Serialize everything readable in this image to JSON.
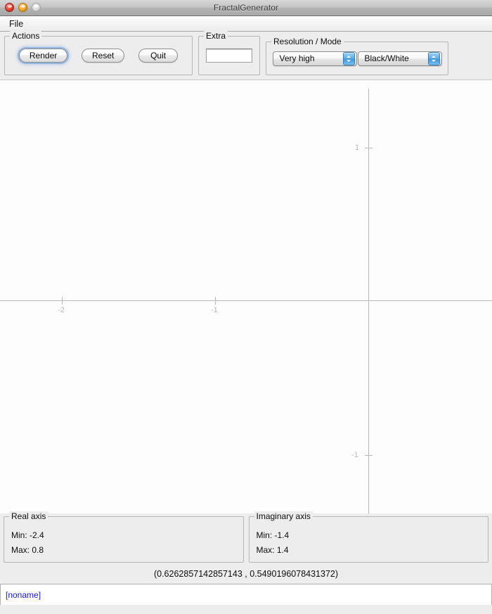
{
  "window": {
    "title": "FractalGenerator",
    "controls": [
      "close-button",
      "minimize-button",
      "zoom-button"
    ]
  },
  "menubar": {
    "items": [
      {
        "label": "File"
      }
    ]
  },
  "toolbar": {
    "actions_group": {
      "label": "Actions",
      "buttons": [
        {
          "label": "Render",
          "default": true
        },
        {
          "label": "Reset",
          "default": false
        },
        {
          "label": "Quit",
          "default": false
        }
      ]
    },
    "extra_group": {
      "label": "Extra",
      "field_value": "",
      "field_placeholder": ""
    },
    "resolution_mode_group": {
      "label": "Resolution / Mode",
      "resolution": {
        "value": "Very high"
      },
      "mode": {
        "value": "Black/White"
      }
    }
  },
  "plot": {
    "x_tick_labels": [
      "-2",
      "-1"
    ],
    "y_tick_labels": [
      "1",
      "-1"
    ]
  },
  "footer": {
    "real_axis": {
      "label": "Real axis",
      "min": "Min: -2.4",
      "max": "Max: 0.8"
    },
    "imaginary_axis": {
      "label": "Imaginary axis",
      "min": "Min: -1.4",
      "max": "Max: 1.4"
    },
    "coordinates": "(0.6262857142857143 , 0.5490196078431372)",
    "status": "[noname]"
  },
  "chart_data": {
    "type": "scatter",
    "title": "",
    "xlabel": "Real axis",
    "ylabel": "Imaginary axis",
    "xlim": [
      -2.4,
      0.8
    ],
    "ylim": [
      -1.4,
      1.4
    ],
    "xticks": [
      -2,
      -1
    ],
    "xticklabels": [
      "-2",
      "-1"
    ],
    "yticks": [
      1,
      -1
    ],
    "yticklabels": [
      "1",
      "-1"
    ],
    "grid": false,
    "legend": null,
    "series": [],
    "annotations": [
      {
        "text": "(0.6262857142857143 , 0.5490196078431372)",
        "role": "cursor-coordinates"
      }
    ]
  }
}
